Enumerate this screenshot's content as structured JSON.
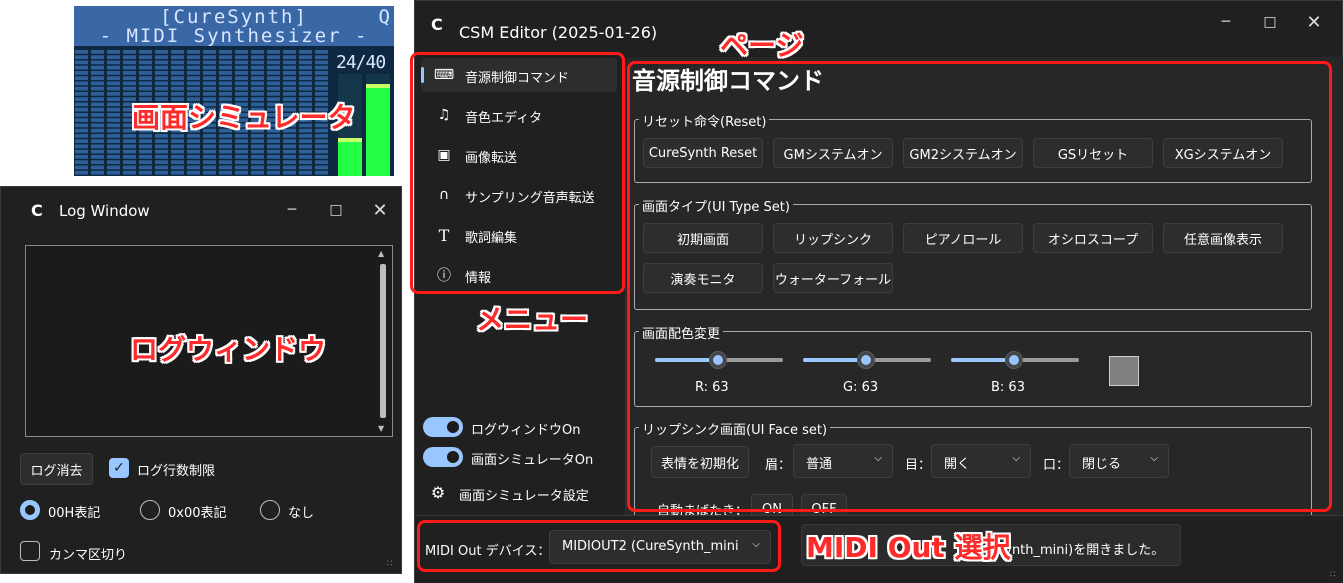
{
  "simulator": {
    "line1": "[CureSynth]",
    "line2": "- MIDI Synthesizer -",
    "counter": "24/40",
    "corner_glyph": "Q",
    "meter_levels": [
      0.33,
      0.86
    ],
    "colors": {
      "bg": "#0d2840",
      "band": "#3a67a6",
      "meter": "#22ff44"
    }
  },
  "log_window": {
    "title": "Log Window",
    "clear_button": "ログ消去",
    "limit_checkbox": {
      "label": "ログ行数制限",
      "checked": true
    },
    "radios": [
      {
        "label": "00H表記",
        "selected": true
      },
      {
        "label": "0x00表記",
        "selected": false
      },
      {
        "label": "なし",
        "selected": false
      }
    ],
    "comma_checkbox": {
      "label": "カンマ区切り",
      "checked": false
    }
  },
  "editor": {
    "title": "CSM Editor (2025-01-26)",
    "nav": [
      {
        "label": "音源制御コマンド",
        "icon": "keyboard-icon",
        "active": true
      },
      {
        "label": "音色エディタ",
        "icon": "music-note-icon",
        "active": false
      },
      {
        "label": "画像転送",
        "icon": "image-icon",
        "active": false
      },
      {
        "label": "サンプリング音声転送",
        "icon": "headphones-icon",
        "active": false
      },
      {
        "label": "歌詞編集",
        "icon": "text-icon",
        "active": false
      },
      {
        "label": "情報",
        "icon": "info-icon",
        "active": false
      }
    ],
    "toggles": [
      {
        "label": "ログウィンドウOn",
        "on": true
      },
      {
        "label": "画面シミュレータOn",
        "on": true
      }
    ],
    "settings_link": "画面シミュレータ設定",
    "page": {
      "title": "音源制御コマンド",
      "reset_group": {
        "label": "リセット命令(Reset)",
        "buttons": [
          "CureSynth Reset",
          "GMシステムオン",
          "GM2システムオン",
          "GSリセット",
          "XGシステムオン"
        ]
      },
      "ui_type_group": {
        "label": "画面タイプ(UI Type Set)",
        "buttons": [
          "初期画面",
          "リップシンク",
          "ピアノロール",
          "オシロスコープ",
          "任意画像表示",
          "演奏モニタ",
          "ウォーターフォール"
        ]
      },
      "color_group": {
        "label": "画面配色変更",
        "sliders": [
          {
            "label": "R: 63",
            "value": 63,
            "max": 127
          },
          {
            "label": "G: 63",
            "value": 63,
            "max": 127
          },
          {
            "label": "B: 63",
            "value": 63,
            "max": 127
          }
        ],
        "swatch_color": "#7f7f7f"
      },
      "face_group": {
        "label": "リップシンク画面(UI Face set)",
        "init_button": "表情を初期化",
        "brow_label": "眉：",
        "brow_value": "普通",
        "eye_label": "目：",
        "eye_value": "開く",
        "mouth_label": "口：",
        "mouth_value": "閉じる",
        "blink_label": "自動まばたき：",
        "blink_on": "ON",
        "blink_off": "OFF"
      }
    },
    "bottom": {
      "midi_label": "MIDI Out デバイス：",
      "midi_value": "MIDIOUT2 (CureSynth_mini",
      "status_text": "eSynth_mini)を開きました。"
    }
  },
  "annotations": {
    "simulator": "画面シミュレータ",
    "log": "ログウィンドウ",
    "menu": "メニュー",
    "page": "ページ",
    "midi": "MIDI Out 選択",
    "color": "#ff1a1a"
  }
}
